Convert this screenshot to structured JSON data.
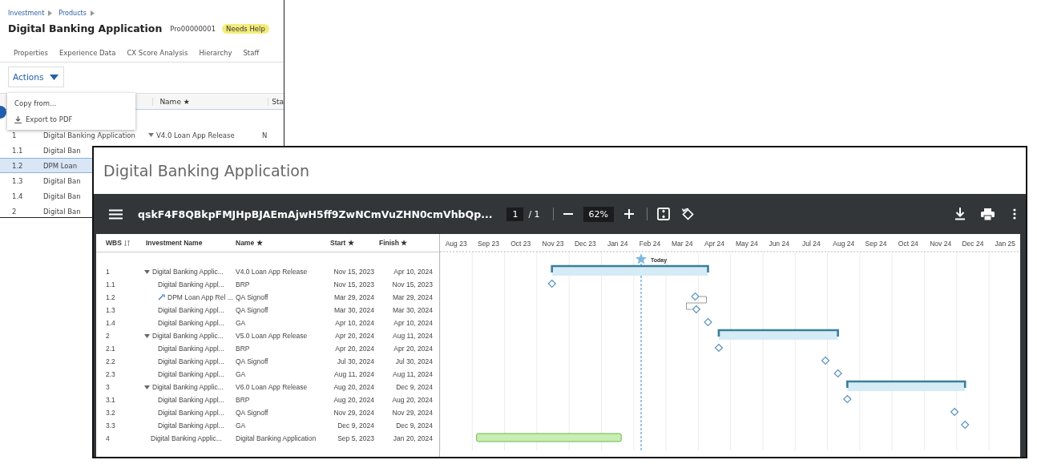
{
  "back_window": {
    "breadcrumb": [
      "Investment",
      "Products"
    ],
    "title": "Digital Banking Application",
    "id": "Pro00000001",
    "status": "Needs Help",
    "tabs": [
      {
        "label": "Properties",
        "selected": false
      },
      {
        "label": "Experience Data",
        "selected": false
      },
      {
        "label": "CX Score Analysis",
        "selected": false
      },
      {
        "label": "Hierarchy",
        "selected": false
      },
      {
        "label": "Staff",
        "selected": false
      }
    ],
    "actions_button": "Actions",
    "actions_menu": [
      {
        "label": "Copy from...",
        "kind": "plain"
      },
      {
        "label": "Export to PDF",
        "kind": "export"
      }
    ],
    "columns": [
      "Name ★",
      "Sta"
    ],
    "rows": [
      {
        "wbs": "1",
        "investment": "Digital Banking Application",
        "name": "V4.0 Loan App Release",
        "expanded": true,
        "column_4": "N",
        "selected": false
      },
      {
        "wbs": "1.1",
        "investment": "Digital Ban",
        "selected": false
      },
      {
        "wbs": "1.2",
        "investment": "DPM Loan",
        "selected": true
      },
      {
        "wbs": "1.3",
        "investment": "Digital Ban",
        "selected": false
      },
      {
        "wbs": "1.4",
        "investment": "Digital Ban",
        "selected": false
      },
      {
        "wbs": "2",
        "investment": "Digital Ban",
        "selected": false
      }
    ]
  },
  "pdf_viewer": {
    "window_title": "Digital Banking Application",
    "file_name": "qskF4F8QBkpFMJHpBJAEmAjwH5ff9ZwNCmVuZHN0cmVhbQp...",
    "page": "1",
    "page_count": "/ 1",
    "zoom": "62%",
    "table": {
      "columns": [
        "WBS",
        "Investment Name",
        "Name ★",
        "Start ★",
        "Finish ★"
      ],
      "rows": [
        {
          "wbs": "1",
          "investment": "Digital Banking Applic...",
          "name": "V4.0 Loan App Release",
          "start": "Nov 15, 2023",
          "finish": "Apr 10, 2024",
          "kind": "summary",
          "expanded": true,
          "children": [
            {
              "wbs": "1.1",
              "investment": "Digital Banking Appl...",
              "name": "BRP",
              "start": "Nov 15, 2023",
              "finish": "Nov 15, 2023",
              "kind": "milestone"
            },
            {
              "wbs": "1.2",
              "investment": "DPM Loan App Rel ...",
              "name": "QA Signoff",
              "start": "Mar 29, 2024",
              "finish": "Mar 29, 2024",
              "kind": "milestone",
              "linked": true
            },
            {
              "wbs": "1.3",
              "investment": "Digital Banking Appl...",
              "name": "QA Signoff",
              "start": "Mar 30, 2024",
              "finish": "Mar 30, 2024",
              "kind": "milestone"
            },
            {
              "wbs": "1.4",
              "investment": "Digital Banking Appl...",
              "name": "GA",
              "start": "Apr 10, 2024",
              "finish": "Apr 10, 2024",
              "kind": "milestone"
            }
          ]
        },
        {
          "wbs": "2",
          "investment": "Digital Banking Applic...",
          "name": "V5.0 Loan App Release",
          "start": "Apr 20, 2024",
          "finish": "Aug 11, 2024",
          "kind": "summary",
          "expanded": true,
          "children": [
            {
              "wbs": "2.1",
              "investment": "Digital Banking Appl...",
              "name": "BRP",
              "start": "Apr 20, 2024",
              "finish": "Apr 20, 2024",
              "kind": "milestone"
            },
            {
              "wbs": "2.2",
              "investment": "Digital Banking Appl...",
              "name": "QA Signoff",
              "start": "Jul 30, 2024",
              "finish": "Jul 30, 2024",
              "kind": "milestone"
            },
            {
              "wbs": "2.3",
              "investment": "Digital Banking Appl...",
              "name": "GA",
              "start": "Aug 11, 2024",
              "finish": "Aug 11, 2024",
              "kind": "milestone"
            }
          ]
        },
        {
          "wbs": "3",
          "investment": "Digital Banking Applic...",
          "name": "V6.0 Loan App Release",
          "start": "Aug 20, 2024",
          "finish": "Dec 9, 2024",
          "kind": "summary",
          "expanded": true,
          "children": [
            {
              "wbs": "3.1",
              "investment": "Digital Banking Appl...",
              "name": "BRP",
              "start": "Aug 20, 2024",
              "finish": "Aug 20, 2024",
              "kind": "milestone"
            },
            {
              "wbs": "3.2",
              "investment": "Digital Banking Appl...",
              "name": "QA Signoff",
              "start": "Nov 29, 2024",
              "finish": "Nov 29, 2024",
              "kind": "milestone"
            },
            {
              "wbs": "3.3",
              "investment": "Digital Banking Appl...",
              "name": "GA",
              "start": "Dec 9, 2024",
              "finish": "Dec 9, 2024",
              "kind": "milestone"
            }
          ]
        },
        {
          "wbs": "4",
          "investment": "Digital Banking Applic...",
          "name": "Digital Banking Application",
          "start": "Sep 5, 2023",
          "finish": "Jan 20, 2024",
          "kind": "task"
        }
      ]
    },
    "gantt": {
      "months": [
        "Aug 23",
        "Sep 23",
        "Oct 23",
        "Nov 23",
        "Dec 23",
        "Jan 24",
        "Feb 24",
        "Mar 24",
        "Apr 24",
        "May 24",
        "Jun 24",
        "Jul 24",
        "Aug 24",
        "Sep 24",
        "Oct 24",
        "Nov 24",
        "Dec 24",
        "Jan 25"
      ],
      "today_label": "Today"
    }
  }
}
